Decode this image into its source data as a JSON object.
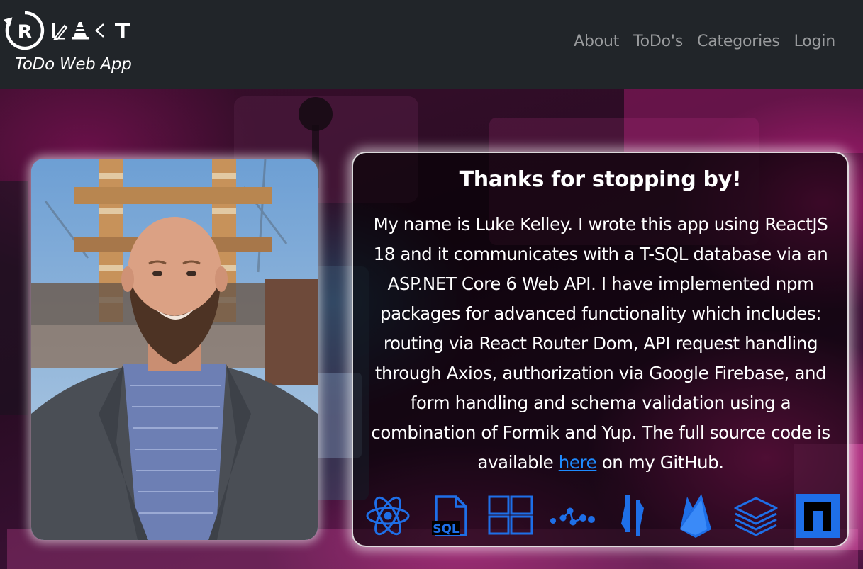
{
  "brand": {
    "tagline": "ToDo Web App",
    "logo_icon": "react-r-logo-icon"
  },
  "nav": {
    "items": [
      {
        "label": "About"
      },
      {
        "label": "ToDo's"
      },
      {
        "label": "Categories"
      },
      {
        "label": "Login"
      }
    ]
  },
  "about": {
    "title": "Thanks for stopping by!",
    "body_before_link": "My name is Luke Kelley. I wrote this app using ReactJS 18 and it communicates with a T-SQL database via an ASP.NET Core 6 Web API. I have implemented npm packages for advanced functionality which includes: routing via React Router Dom, API request handling through Axios, authorization via Google Firebase, and form handling and schema validation using a combination of Formik and Yup. The full source code is available ",
    "link_text": "here",
    "body_after_link": " on my GitHub.",
    "photo": "profile-photo"
  },
  "tech_icons": [
    "react-icon",
    "sql-file-icon",
    "windows-icon",
    "react-router-icon",
    "axios-icon",
    "firebase-icon",
    "stack-layers-icon",
    "npm-n-icon"
  ],
  "colors": {
    "navbar_bg": "#212529",
    "nav_link": "#8c8f93",
    "accent_blue": "#1e6fe8",
    "link_blue": "#1e8bff",
    "hero_pink": "#e62896"
  }
}
